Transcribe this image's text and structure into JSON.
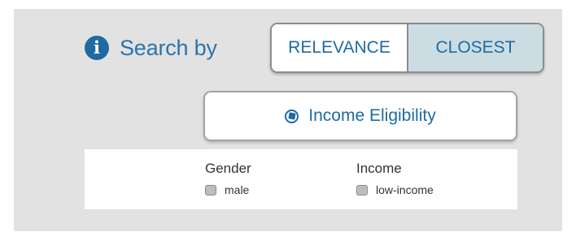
{
  "search": {
    "label": "Search by",
    "info_icon": "info-icon",
    "info_glyph": "i",
    "options": [
      "RELEVANCE",
      "CLOSEST"
    ],
    "selected": "CLOSEST"
  },
  "eligibility": {
    "label": "Income Eligibility",
    "icon": "compass-icon"
  },
  "filters": {
    "gender": {
      "title": "Gender",
      "option": "male"
    },
    "income": {
      "title": "Income",
      "option": "low-income"
    }
  },
  "colors": {
    "accent": "#1f6aa3",
    "panel_bg": "#e2e2e2",
    "selected_bg": "#cbdde2"
  }
}
